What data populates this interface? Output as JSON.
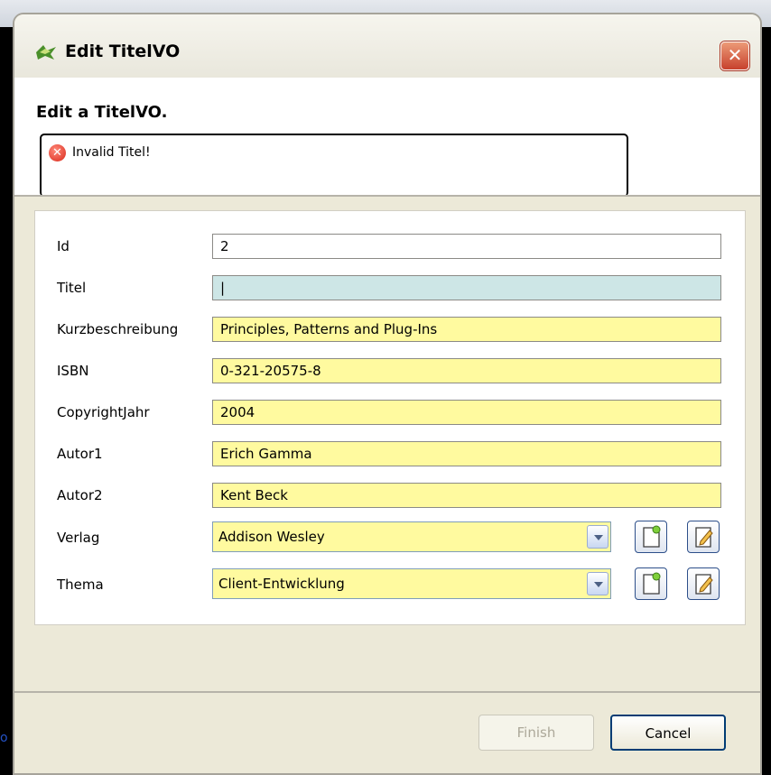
{
  "window": {
    "title": "Edit TitelVO",
    "close_glyph": "✕"
  },
  "header": {
    "title": "Edit a TitelVO.",
    "error_message": "Invalid Titel!"
  },
  "form": {
    "fields": [
      {
        "label": "Id",
        "value": "2"
      },
      {
        "label": "Titel",
        "value": "|"
      },
      {
        "label": "Kurzbeschreibung",
        "value": "Principles, Patterns and Plug-Ins"
      },
      {
        "label": "ISBN",
        "value": "0-321-20575-8"
      },
      {
        "label": "CopyrightJahr",
        "value": "2004"
      },
      {
        "label": "Autor1",
        "value": "Erich Gamma"
      },
      {
        "label": "Autor2",
        "value": "Kent Beck"
      }
    ],
    "verlag": {
      "label": "Verlag",
      "value": "Addison Wesley"
    },
    "thema": {
      "label": "Thema",
      "value": "Client-Entwicklung"
    }
  },
  "buttons": {
    "finish": "Finish",
    "cancel": "Cancel"
  },
  "background_fragment": "o",
  "colors": {
    "required_field": "#fffa9f",
    "invalid_field": "#cde6e6",
    "dialog_bg": "#ece9d8",
    "error_red": "#d9281a"
  }
}
